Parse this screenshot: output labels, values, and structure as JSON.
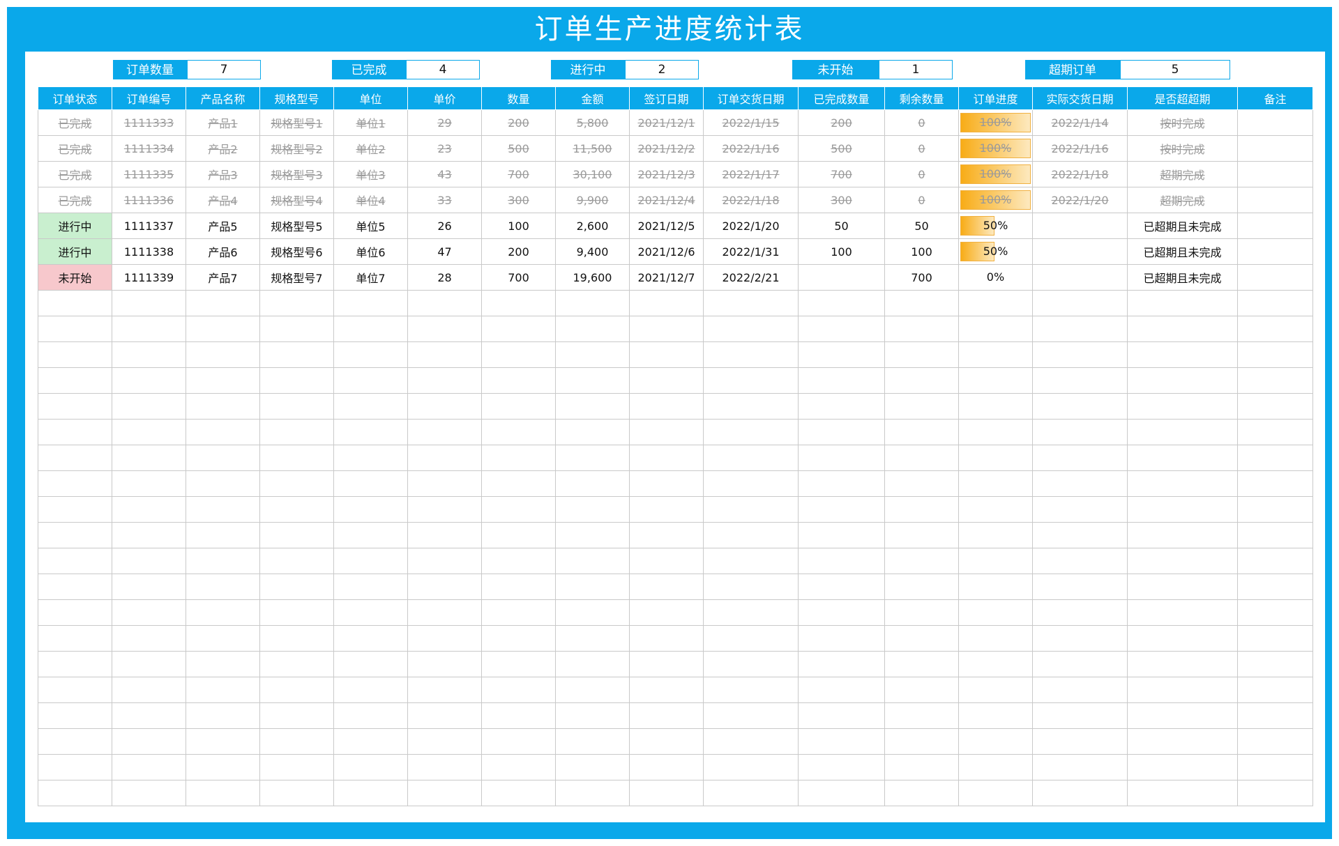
{
  "title": "订单生产进度统计表",
  "summary": [
    {
      "label": "订单数量",
      "value": "7"
    },
    {
      "label": "已完成",
      "value": "4"
    },
    {
      "label": "进行中",
      "value": "2"
    },
    {
      "label": "未开始",
      "value": "1"
    },
    {
      "label": "超期订单",
      "value": "5"
    }
  ],
  "columns": [
    "订单状态",
    "订单编号",
    "产品名称",
    "规格型号",
    "单位",
    "单价",
    "数量",
    "金额",
    "签订日期",
    "订单交货日期",
    "已完成数量",
    "剩余数量",
    "订单进度",
    "实际交货日期",
    "是否超超期",
    "备注"
  ],
  "rows": [
    {
      "status": "已完成",
      "order_no": "1111333",
      "product": "产品1",
      "spec": "规格型号1",
      "unit": "单位1",
      "price": "29",
      "qty": "200",
      "amount": "5,800",
      "sign_date": "2021/12/1",
      "delivery_date": "2022/1/15",
      "done_qty": "200",
      "remain_qty": "0",
      "progress": 1.0,
      "progress_label": "100%",
      "actual_date": "2022/1/14",
      "overdue": "按时完成",
      "note": ""
    },
    {
      "status": "已完成",
      "order_no": "1111334",
      "product": "产品2",
      "spec": "规格型号2",
      "unit": "单位2",
      "price": "23",
      "qty": "500",
      "amount": "11,500",
      "sign_date": "2021/12/2",
      "delivery_date": "2022/1/16",
      "done_qty": "500",
      "remain_qty": "0",
      "progress": 1.0,
      "progress_label": "100%",
      "actual_date": "2022/1/16",
      "overdue": "按时完成",
      "note": ""
    },
    {
      "status": "已完成",
      "order_no": "1111335",
      "product": "产品3",
      "spec": "规格型号3",
      "unit": "单位3",
      "price": "43",
      "qty": "700",
      "amount": "30,100",
      "sign_date": "2021/12/3",
      "delivery_date": "2022/1/17",
      "done_qty": "700",
      "remain_qty": "0",
      "progress": 1.0,
      "progress_label": "100%",
      "actual_date": "2022/1/18",
      "overdue": "超期完成",
      "note": ""
    },
    {
      "status": "已完成",
      "order_no": "1111336",
      "product": "产品4",
      "spec": "规格型号4",
      "unit": "单位4",
      "price": "33",
      "qty": "300",
      "amount": "9,900",
      "sign_date": "2021/12/4",
      "delivery_date": "2022/1/18",
      "done_qty": "300",
      "remain_qty": "0",
      "progress": 1.0,
      "progress_label": "100%",
      "actual_date": "2022/1/20",
      "overdue": "超期完成",
      "note": ""
    },
    {
      "status": "进行中",
      "order_no": "1111337",
      "product": "产品5",
      "spec": "规格型号5",
      "unit": "单位5",
      "price": "26",
      "qty": "100",
      "amount": "2,600",
      "sign_date": "2021/12/5",
      "delivery_date": "2022/1/20",
      "done_qty": "50",
      "remain_qty": "50",
      "progress": 0.5,
      "progress_label": "50%",
      "actual_date": "",
      "overdue": "已超期且未完成",
      "note": ""
    },
    {
      "status": "进行中",
      "order_no": "1111338",
      "product": "产品6",
      "spec": "规格型号6",
      "unit": "单位6",
      "price": "47",
      "qty": "200",
      "amount": "9,400",
      "sign_date": "2021/12/6",
      "delivery_date": "2022/1/31",
      "done_qty": "100",
      "remain_qty": "100",
      "progress": 0.5,
      "progress_label": "50%",
      "actual_date": "",
      "overdue": "已超期且未完成",
      "note": ""
    },
    {
      "status": "未开始",
      "order_no": "1111339",
      "product": "产品7",
      "spec": "规格型号7",
      "unit": "单位7",
      "price": "28",
      "qty": "700",
      "amount": "19,600",
      "sign_date": "2021/12/7",
      "delivery_date": "2022/2/21",
      "done_qty": "",
      "remain_qty": "700",
      "progress": 0,
      "progress_label": "0%",
      "actual_date": "",
      "overdue": "已超期且未完成",
      "note": ""
    }
  ],
  "status_colors": {
    "已完成": "#9a9a9a",
    "进行中": "#c9efcf",
    "未开始": "#f7c8cc"
  },
  "accent_color": "#0aa8ea",
  "progress_color": "#f8ac17"
}
